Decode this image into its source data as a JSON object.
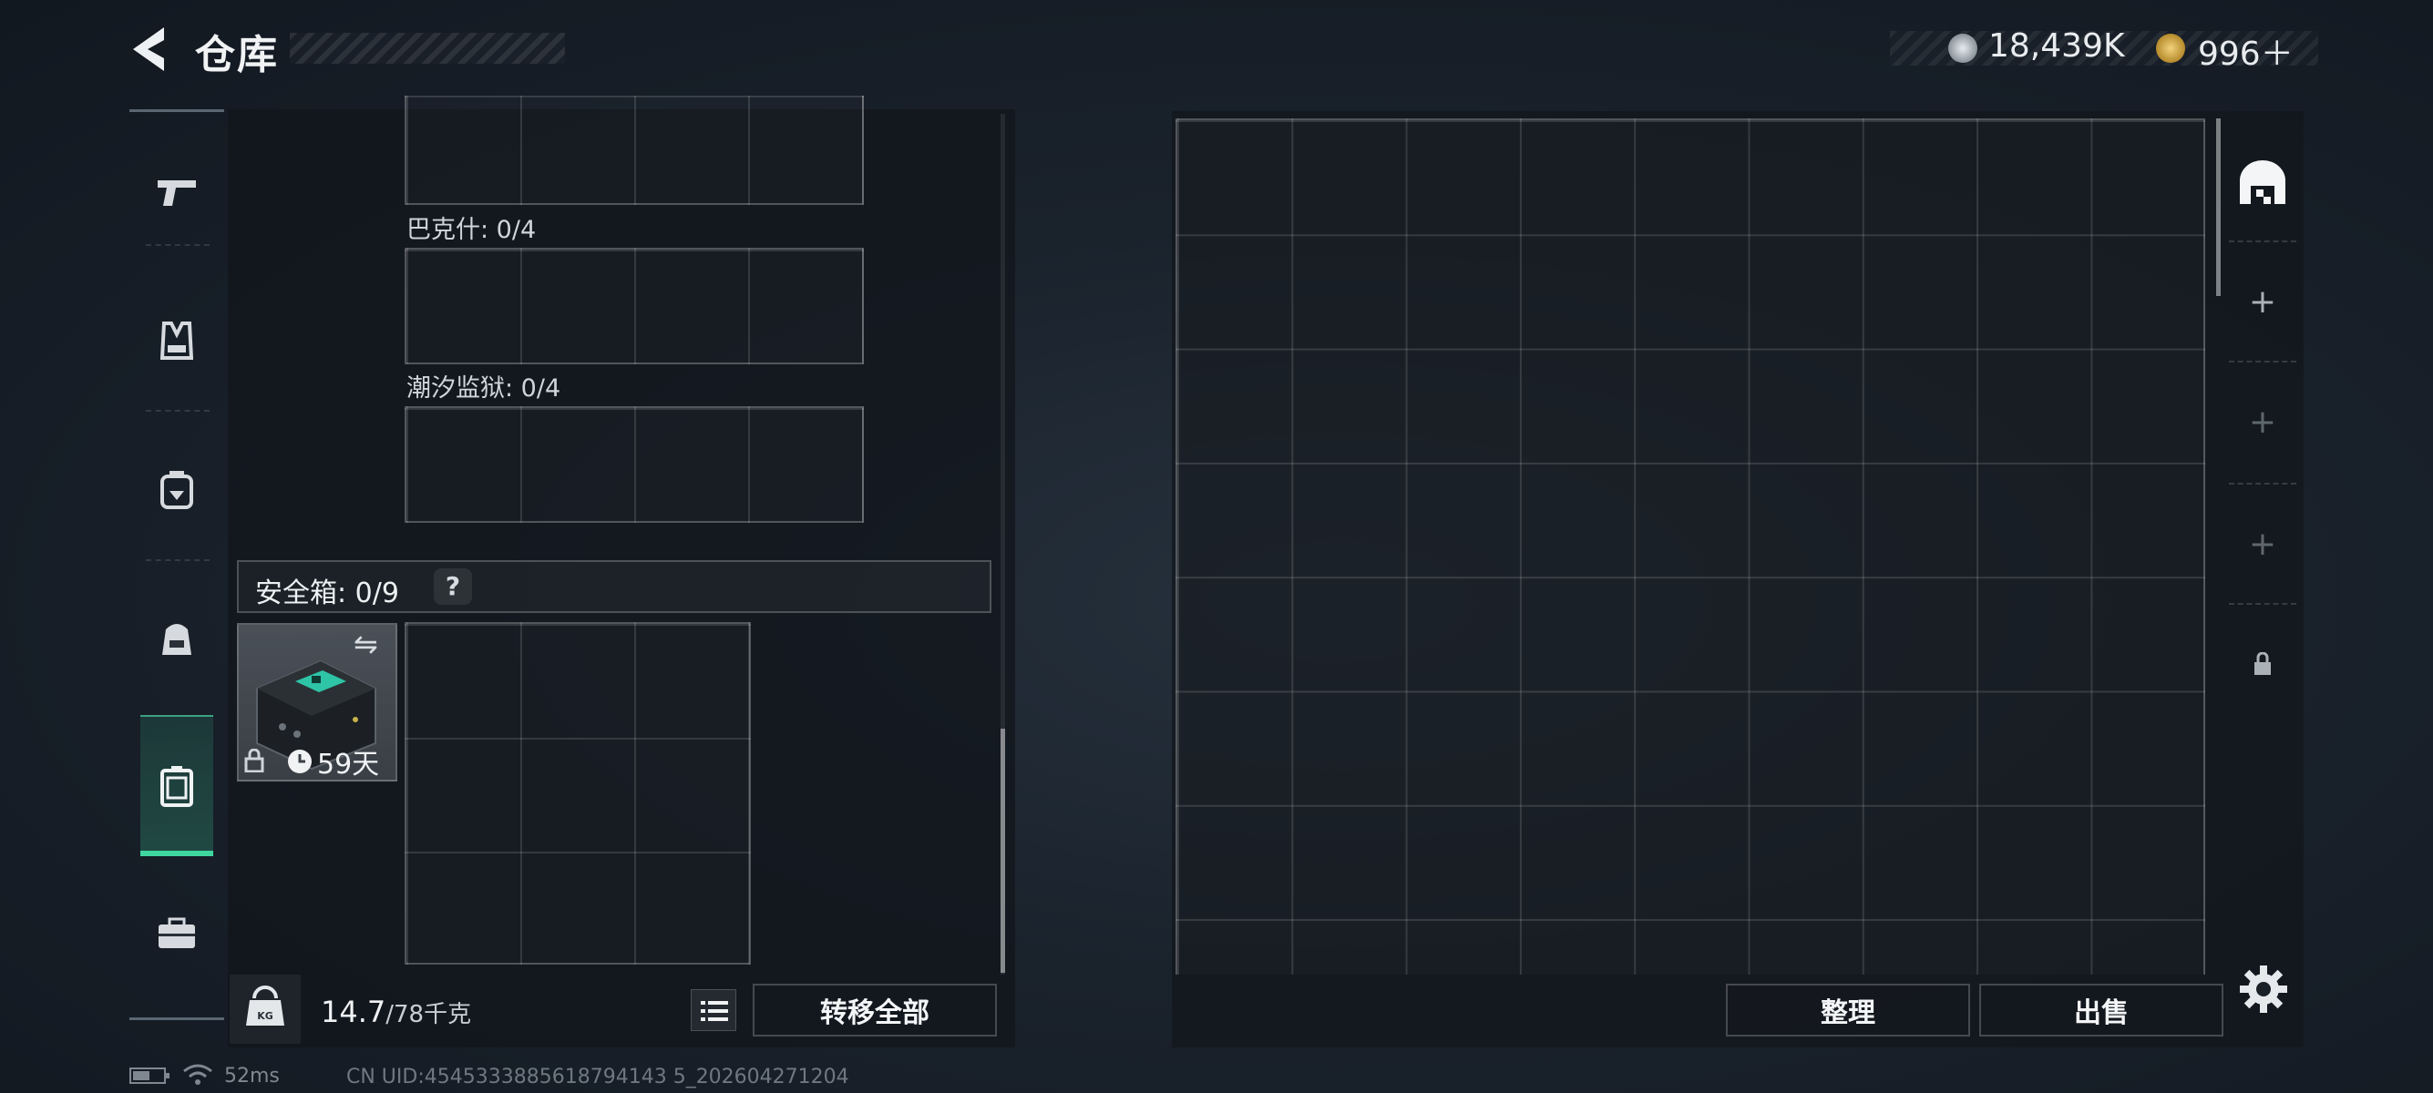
{
  "header": {
    "title": "仓库",
    "currency": [
      {
        "icon": "silver-coin-icon",
        "value": "18,439K"
      },
      {
        "icon": "gold-coin-icon",
        "value": "996＋"
      }
    ]
  },
  "nav": {
    "items": [
      {
        "icon": "pistol-icon"
      },
      {
        "icon": "vest-icon"
      },
      {
        "icon": "backpack-icon"
      },
      {
        "icon": "pack-icon"
      },
      {
        "icon": "safe-box-icon",
        "active": true
      },
      {
        "icon": "toolbox-icon"
      }
    ]
  },
  "left_panel": {
    "grid_labels": [
      "巴克什: 0/4",
      "潮汐监狱: 0/4"
    ],
    "safe_box": {
      "label": "安全箱: 0/9",
      "help": "?",
      "item_days": "59天"
    },
    "weight": {
      "current": "14.7",
      "max": "/78千克"
    },
    "transfer_label": "转移全部"
  },
  "right_panel": {
    "tidy_label": "整理",
    "sell_label": "出售",
    "side_items": [
      "home-storage-icon",
      "add-icon",
      "add-icon",
      "add-icon",
      "lock-icon"
    ]
  },
  "status": {
    "ping": "52ms",
    "uid": "CN UID:4545333885618794143 5_202604271204"
  },
  "colors": {
    "accent": "#3fd6a0",
    "panel": "#12161c"
  }
}
